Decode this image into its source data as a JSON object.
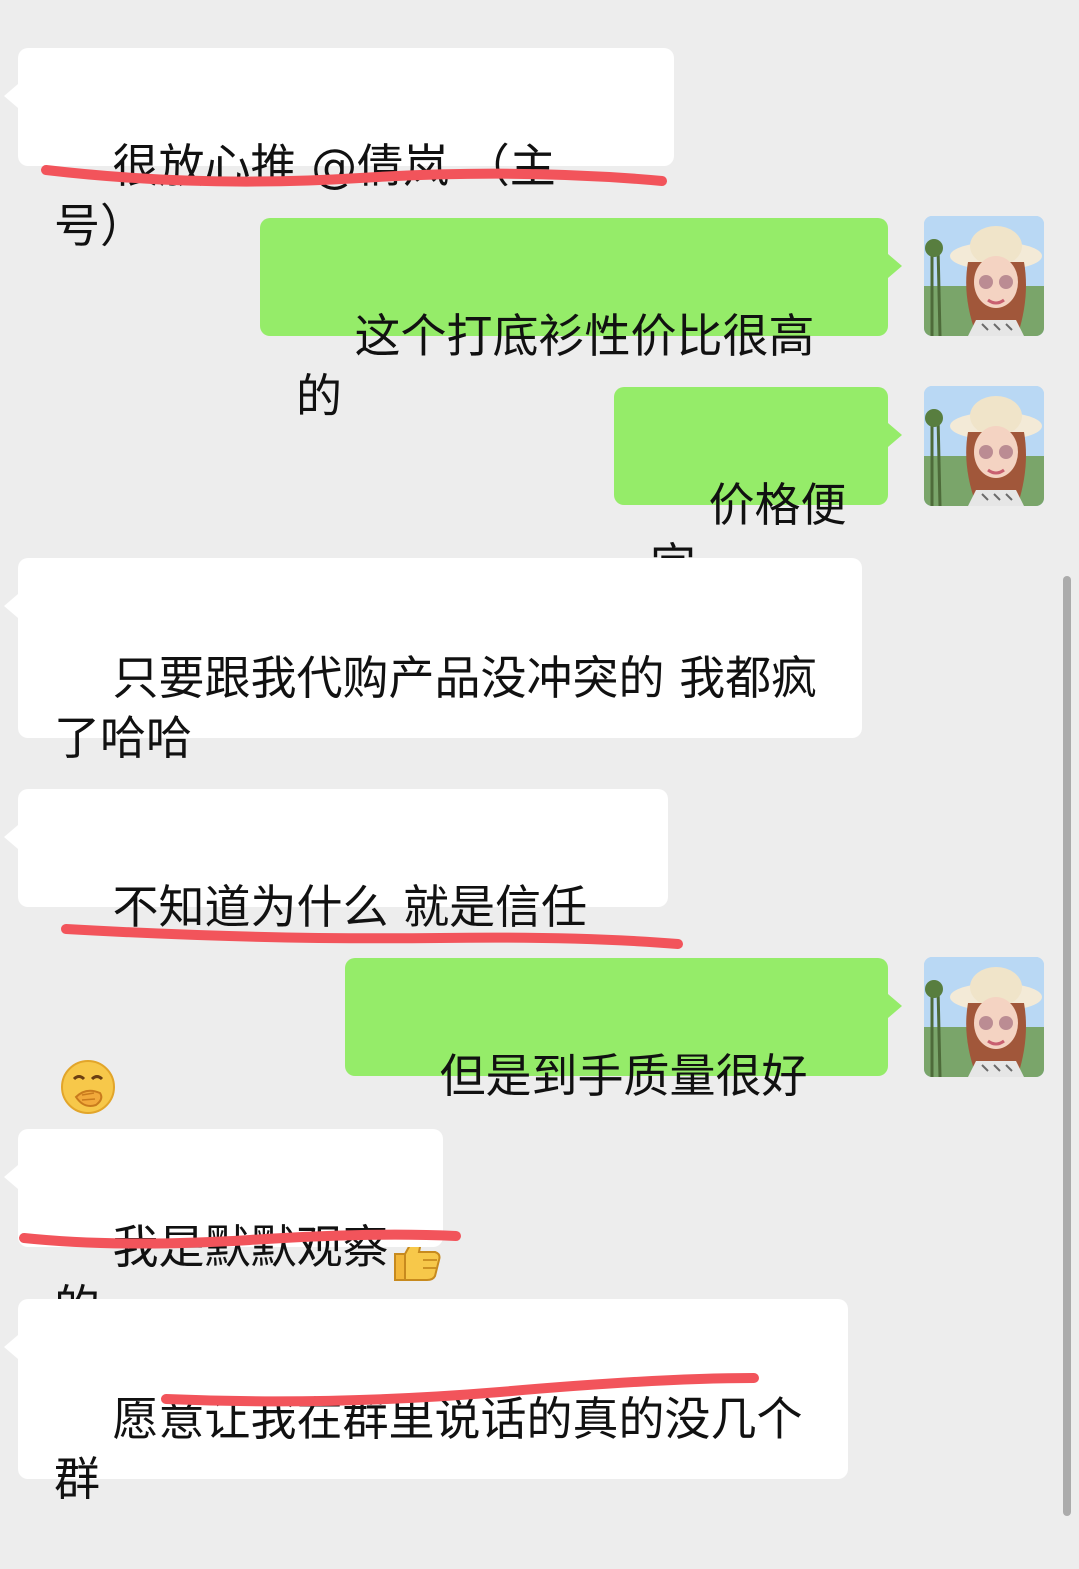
{
  "messages": [
    {
      "side": "left",
      "text": "很放心推 @倩岚 （主号）"
    },
    {
      "side": "right",
      "text": "这个打底衫性价比很高的",
      "avatar_icon": "user-avatar-icon"
    },
    {
      "side": "right",
      "text": "价格便宜",
      "avatar_icon": "user-avatar-icon"
    },
    {
      "side": "left",
      "text": "只要跟我代购产品没冲突的 我都疯了哈哈"
    },
    {
      "side": "left",
      "text": "不知道为什么 就是信任",
      "emoji": "hand-over-mouth-emoji"
    },
    {
      "side": "right",
      "text": "但是到手质量很好",
      "emoji": "thumbs-up-emoji",
      "avatar_icon": "user-avatar-icon"
    },
    {
      "side": "left",
      "text": "我是默默观察的"
    },
    {
      "side": "left",
      "text": "愿意让我在群里说话的真的没几个群"
    }
  ],
  "colors": {
    "background": "#ededed",
    "incoming_bubble": "#ffffff",
    "outgoing_bubble": "#95ec69",
    "annotation_underline": "#f2545b"
  }
}
